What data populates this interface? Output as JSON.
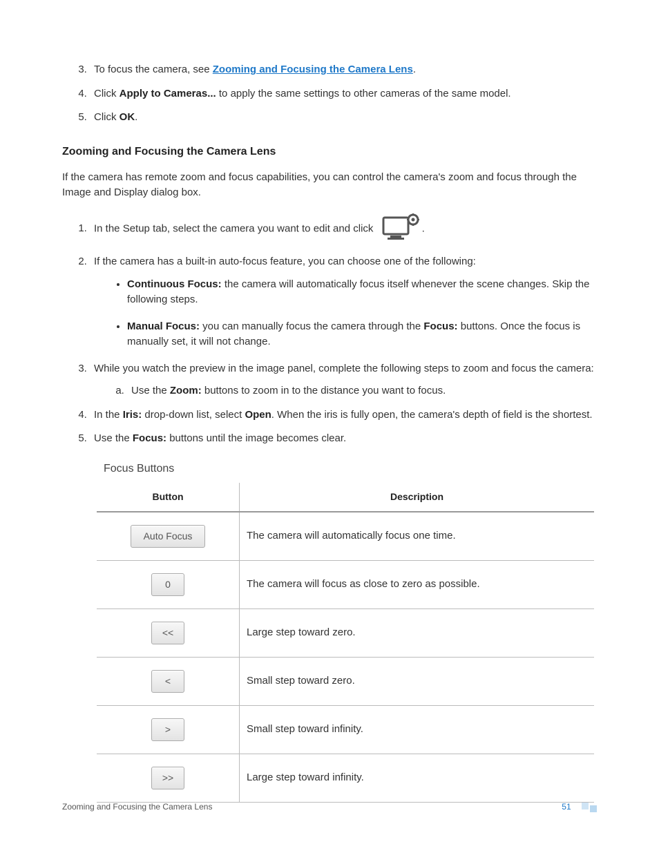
{
  "topList": {
    "item3_pre": "To focus the camera, see ",
    "item3_link": "Zooming and Focusing the Camera Lens",
    "item3_post": ".",
    "item4_pre": "Click ",
    "item4_bold": "Apply to Cameras...",
    "item4_post": " to apply the same settings to other cameras of the same model.",
    "item5_pre": "Click ",
    "item5_bold": "OK",
    "item5_post": "."
  },
  "sectionHeading": "Zooming and Focusing the Camera Lens",
  "intro": "If the camera has remote zoom and focus capabilities, you can control the camera's zoom and focus through the Image and Display dialog box.",
  "steps": {
    "s1_pre": "In the Setup tab, select the camera you want to edit and click ",
    "s1_post": ".",
    "s2": "If the camera has a built-in auto-focus feature, you can choose one of the following:",
    "s2_b1_label": "Continuous Focus:",
    "s2_b1_text": " the camera will automatically focus itself whenever the scene changes. Skip the following steps.",
    "s2_b2_label": "Manual Focus:",
    "s2_b2_text_a": " you can manually focus the camera through the ",
    "s2_b2_bold": "Focus:",
    "s2_b2_text_b": " buttons. Once the focus is manually set, it will not change.",
    "s3": "While you watch the preview in the image panel, complete the following steps to zoom and focus the camera:",
    "s3_a_pre": "Use the ",
    "s3_a_bold": "Zoom:",
    "s3_a_post": " buttons to zoom in to the distance you want to focus.",
    "s4_pre": "In the ",
    "s4_bold1": "Iris:",
    "s4_mid": " drop-down list, select ",
    "s4_bold2": "Open",
    "s4_post": ". When the iris is fully open, the camera's depth of field is the shortest.",
    "s5_pre": "Use the ",
    "s5_bold": "Focus:",
    "s5_post": " buttons until the image becomes clear."
  },
  "tableTitle": "Focus Buttons",
  "table": {
    "h1": "Button",
    "h2": "Description",
    "rows": [
      {
        "btn": "Auto Focus",
        "wide": true,
        "desc": "The camera will automatically focus one time."
      },
      {
        "btn": "0",
        "wide": false,
        "desc": "The camera will focus as close to zero as possible."
      },
      {
        "btn": "<<",
        "wide": false,
        "desc": "Large step toward zero."
      },
      {
        "btn": "<",
        "wide": false,
        "desc": "Small step toward zero."
      },
      {
        "btn": ">",
        "wide": false,
        "desc": "Small step toward infinity."
      },
      {
        "btn": ">>",
        "wide": false,
        "desc": "Large step toward infinity."
      }
    ]
  },
  "footer": {
    "title": "Zooming and Focusing the Camera Lens",
    "page": "51"
  }
}
